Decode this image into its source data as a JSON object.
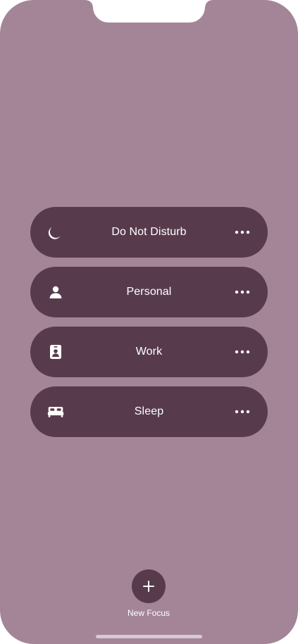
{
  "focus_modes": [
    {
      "label": "Do Not Disturb",
      "icon": "moon-icon"
    },
    {
      "label": "Personal",
      "icon": "person-icon"
    },
    {
      "label": "Work",
      "icon": "id-badge-icon"
    },
    {
      "label": "Sleep",
      "icon": "bed-icon"
    }
  ],
  "new_focus": {
    "label": "New Focus",
    "icon": "plus-icon"
  },
  "colors": {
    "background": "#a48598",
    "item_background": "#573b4d",
    "text": "#ffffff"
  }
}
